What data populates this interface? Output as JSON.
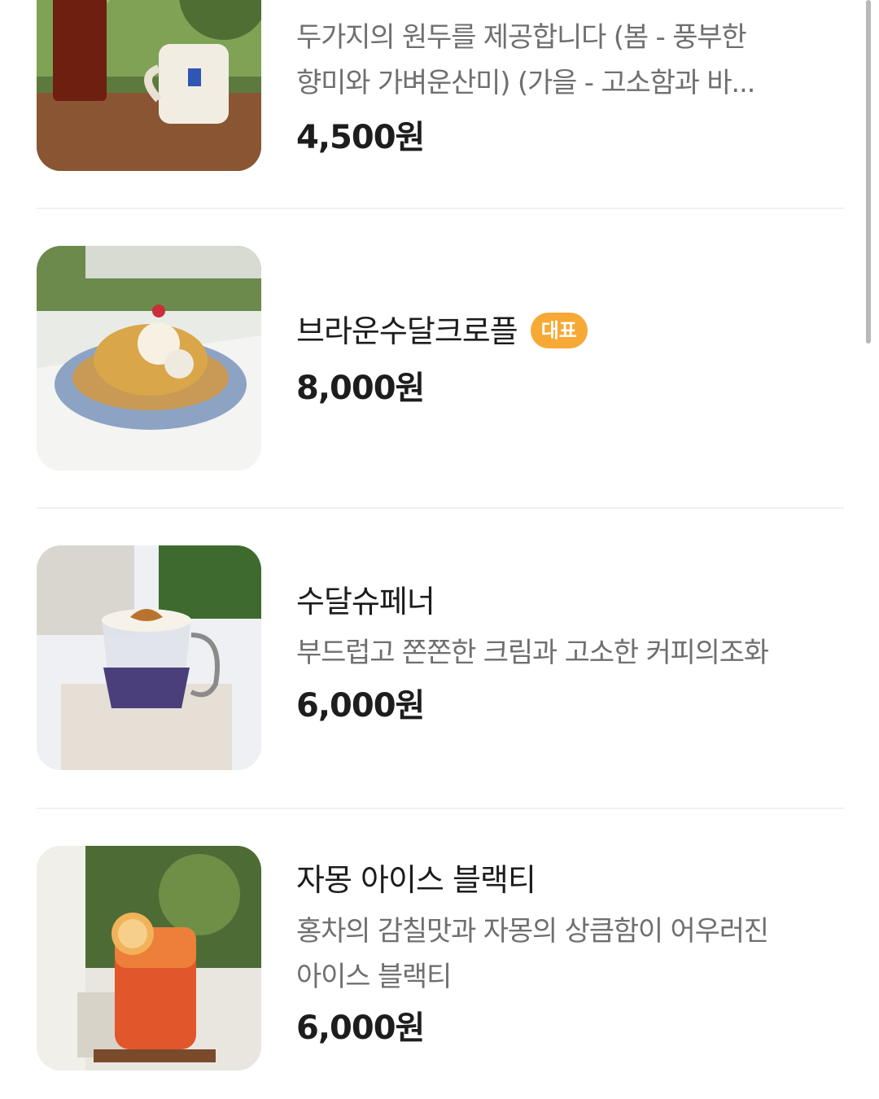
{
  "menu_items": [
    {
      "name": "",
      "description_line1": "두가지의 원두를 제공합니다 (봄 - 풍부한",
      "description_line2": "향미와 가벼운산미) (가을 - 고소함과 바...",
      "price": "4,500원",
      "image": "iced-americano-and-mug-photo"
    },
    {
      "name": "브라운수달크로플",
      "badge": "대표",
      "price": "8,000원",
      "image": "croffle-dessert-photo"
    },
    {
      "name": "수달슈페너",
      "description_line1": "부드럽고 쫀쫀한 크림과 고소한 커피의조화",
      "price": "6,000원",
      "image": "einspanner-glass-photo"
    },
    {
      "name": "자몽 아이스 블랙티",
      "description_line1": "홍차의 감칠맛과 자몽의 상큼함이 어우러진",
      "description_line2": "아이스 블랙티",
      "price": "6,000원",
      "image": "grapefruit-iced-tea-photo"
    }
  ],
  "colors": {
    "badge": "#f7a935",
    "price": "#1d1d1d",
    "description": "#6f6f6f",
    "divider": "#f0f0f0"
  }
}
